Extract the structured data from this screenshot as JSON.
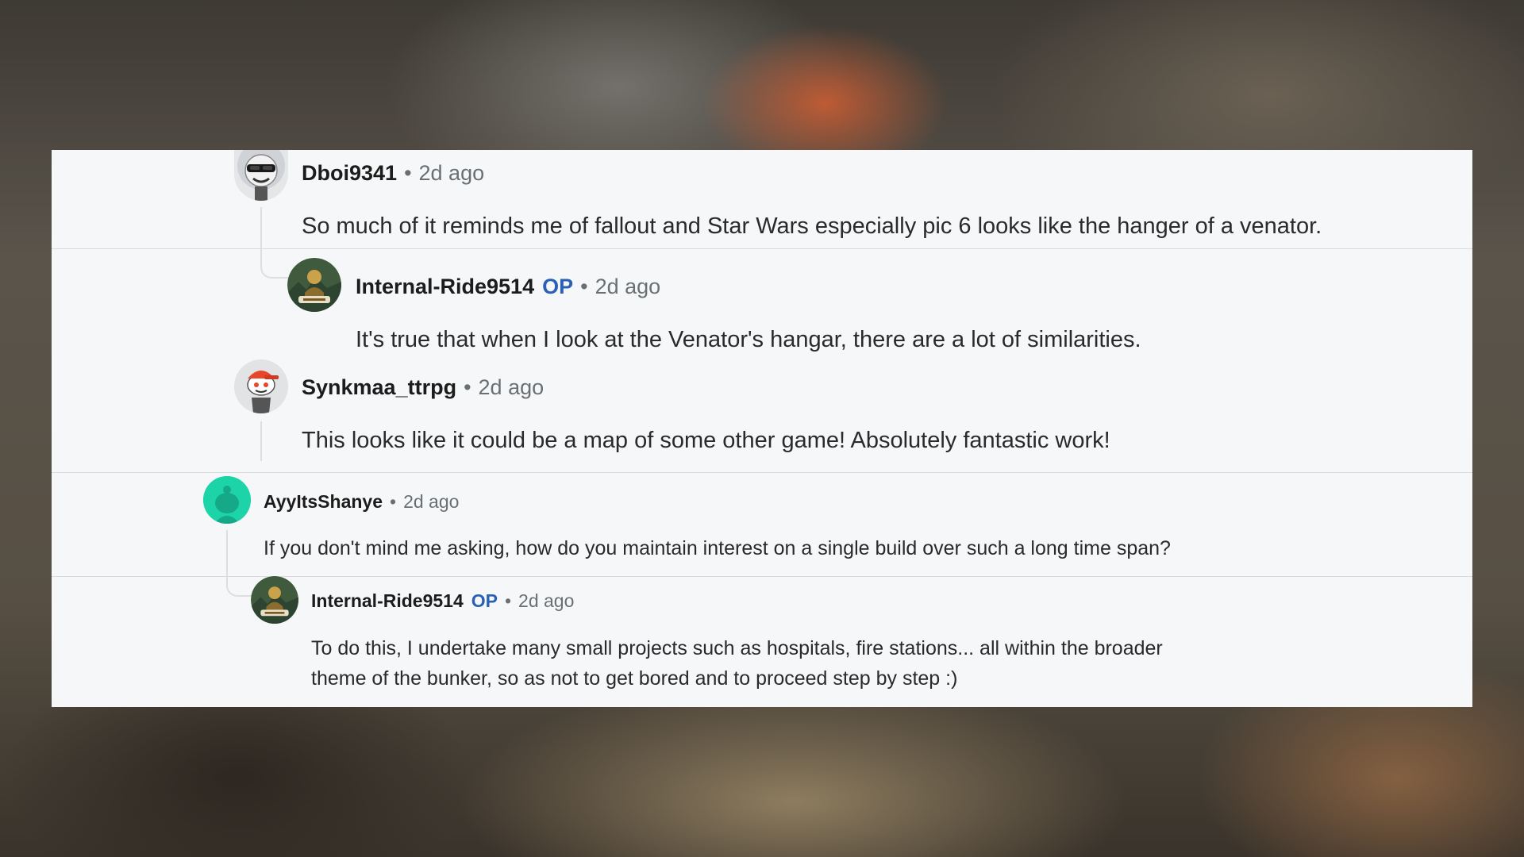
{
  "comments": [
    {
      "username": "Dboi9341",
      "op": "",
      "dot": "•",
      "time": "2d ago",
      "text": "So much of it reminds me of fallout and Star Wars especially pic 6 looks like the hanger of a venator.",
      "avatar": "robot-sunglasses-avatar"
    },
    {
      "username": "Internal-Ride9514",
      "op": "OP",
      "dot": "•",
      "time": "2d ago",
      "text": "It's true that when I look at the Venator's hangar, there are a lot of similarities.",
      "avatar": "dicaprio-character-avatar"
    },
    {
      "username": "Synkmaa_ttrpg",
      "op": "",
      "dot": "•",
      "time": "2d ago",
      "text": "This looks like it could be a map of some other game! Absolutely fantastic work!",
      "avatar": "snoo-red-cap-avatar"
    },
    {
      "username": "AyyItsShanye",
      "op": "",
      "dot": "•",
      "time": "2d ago",
      "text": "If you don't mind me asking, how do you maintain interest on a single build over such a long time span?",
      "avatar": "default-teal-snoo-avatar"
    },
    {
      "username": "Internal-Ride9514",
      "op": "OP",
      "dot": "•",
      "time": "2d ago",
      "text_line1": "To do this, I undertake many small projects such as hospitals, fire stations... all within the broader",
      "text_line2": "theme of the bunker, so as not to get bored and to proceed step by step :)",
      "avatar": "dicaprio-character-avatar"
    }
  ],
  "colors": {
    "op": "#2a61b5",
    "card": "#f6f7f8",
    "teal_avatar": "#1dd3a8"
  }
}
